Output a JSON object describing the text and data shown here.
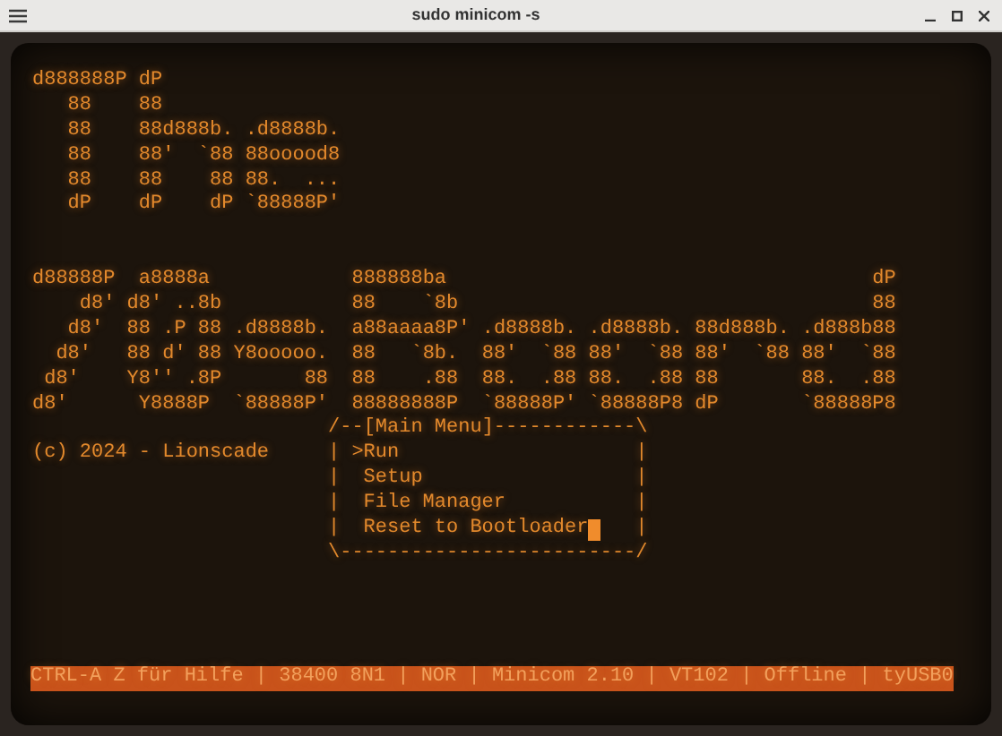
{
  "window": {
    "title": "sudo minicom -s"
  },
  "terminal": {
    "banner_top": [
      "d888888P dP",
      "   88    88",
      "   88    88d888b. .d8888b.",
      "   88    88'  `88 88ooood8",
      "   88    88    88 88.  ...",
      "   dP    dP    dP `88888P'"
    ],
    "banner_bottom": [
      "d88888P  a8888a            888888ba                                    dP",
      "    d8' d8' ..8b           88    `8b                                   88",
      "   d8'  88 .P 88 .d8888b.  a88aaaa8P' .d8888b. .d8888b. 88d888b. .d888b88",
      "  d8'   88 d' 88 Y8ooooo.  88   `8b.  88'  `88 88'  `88 88'  `88 88'  `88",
      " d8'    Y8'' .8P       88  88    .88  88.  .88 88.  .88 88       88.  .88",
      "d8'      Y8888P  `88888P'  88888888P  `88888P' `88888P8 dP       `88888P8"
    ],
    "copyright": "(c) 2024 - Lionscade",
    "menu": {
      "border_top": "/--[Main Menu]------------\\",
      "border_bottom": "\\-------------------------/",
      "side": "|",
      "marker": ">",
      "items": [
        {
          "label": "Run",
          "selected": true,
          "cursor": false
        },
        {
          "label": "Setup",
          "selected": false,
          "cursor": false
        },
        {
          "label": "File Manager",
          "selected": false,
          "cursor": false
        },
        {
          "label": "Reset to Bootloader",
          "selected": false,
          "cursor": true
        }
      ]
    },
    "status_bar": "CTRL-A Z für Hilfe | 38400 8N1 | NOR | Minicom 2.10 | VT102 | Offline | tyUSB0"
  }
}
